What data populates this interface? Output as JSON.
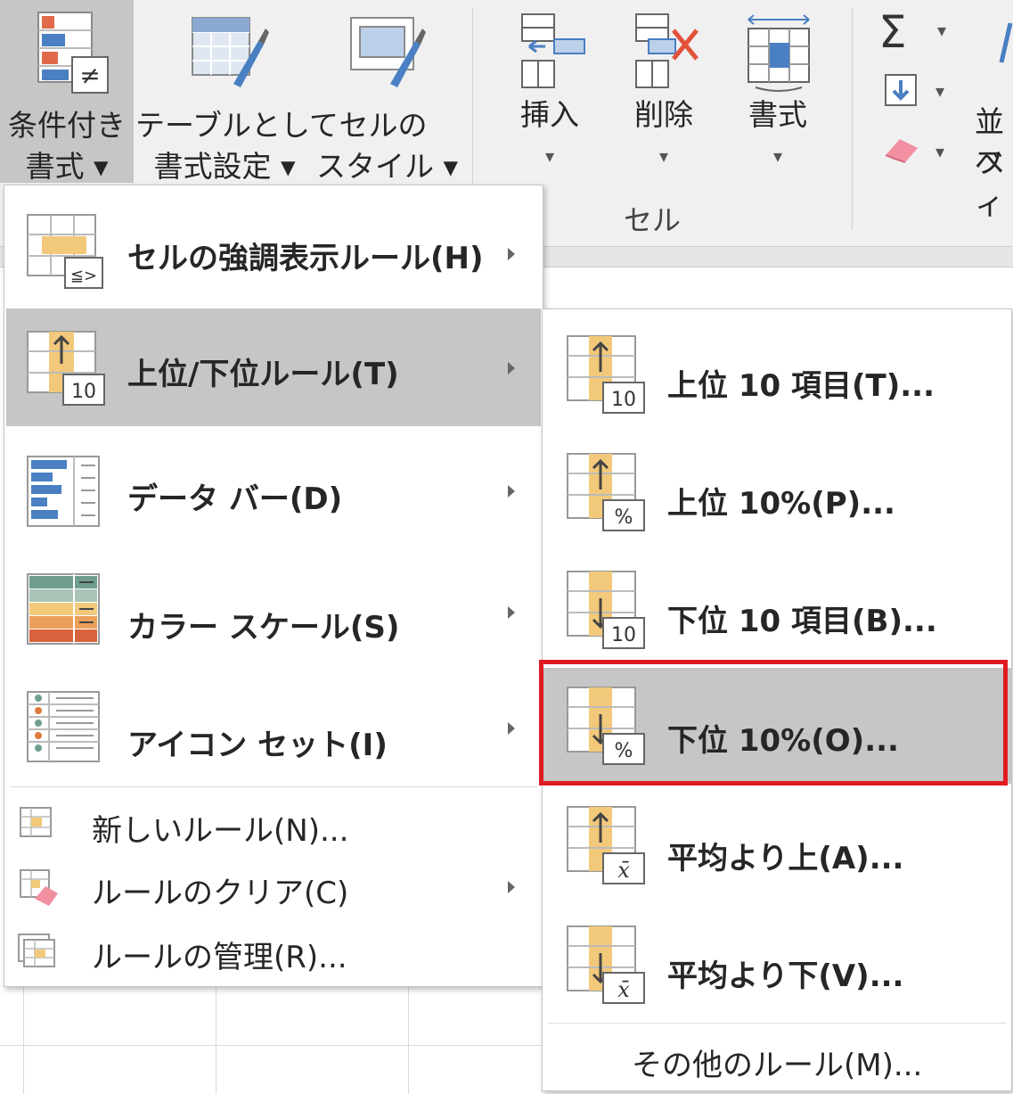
{
  "ribbon": {
    "conditional": {
      "line1": "条件付き",
      "line2": "書式 ▾"
    },
    "table_format": {
      "line1": "テーブルとして",
      "line2": "書式設定 ▾"
    },
    "cell_styles": {
      "line1": "セルの",
      "line2": "スタイル ▾"
    },
    "insert": {
      "label": "挿入",
      "caret": "▾"
    },
    "delete": {
      "label": "削除",
      "caret": "▾"
    },
    "format": {
      "label": "書式",
      "caret": "▾"
    },
    "group_cells": "セル",
    "sort_label": {
      "line1": "並べ",
      "line2": "フィ"
    },
    "sigma": "Σ",
    "caret_small": "▾"
  },
  "main_menu": {
    "items": [
      {
        "label": "セルの強調表示ルール(H)",
        "mnemonic": "H"
      },
      {
        "label": "上位/下位ルール(T)",
        "mnemonic": "T"
      },
      {
        "label": "データ バー(D)",
        "mnemonic": "D"
      },
      {
        "label": "カラー スケール(S)",
        "mnemonic": "S"
      },
      {
        "label": "アイコン セット(I)",
        "mnemonic": "I"
      },
      {
        "label": "新しいルール(N)...",
        "mnemonic": "N"
      },
      {
        "label": "ルールのクリア(C)",
        "mnemonic": "C"
      },
      {
        "label": "ルールの管理(R)...",
        "mnemonic": "R"
      }
    ],
    "icon_badges": {
      "highlight": "≦>",
      "topbottom": "10"
    }
  },
  "sub_menu": {
    "items": [
      {
        "label": "上位 10 項目(T)...",
        "badge": "10"
      },
      {
        "label": "上位 10%(P)...",
        "badge": "%"
      },
      {
        "label": "下位 10 項目(B)...",
        "badge": "10"
      },
      {
        "label": "下位 10%(O)...",
        "badge": "%"
      },
      {
        "label": "平均より上(A)...",
        "badge": "x̄"
      },
      {
        "label": "平均より下(V)...",
        "badge": "x̄"
      }
    ],
    "more_rules": "その他のルール(M)..."
  },
  "colors": {
    "highlight": "#c6c6c6",
    "selection_border": "#e01a22",
    "icon_orange": "#f2c97a",
    "icon_blue": "#4a7fc2"
  }
}
